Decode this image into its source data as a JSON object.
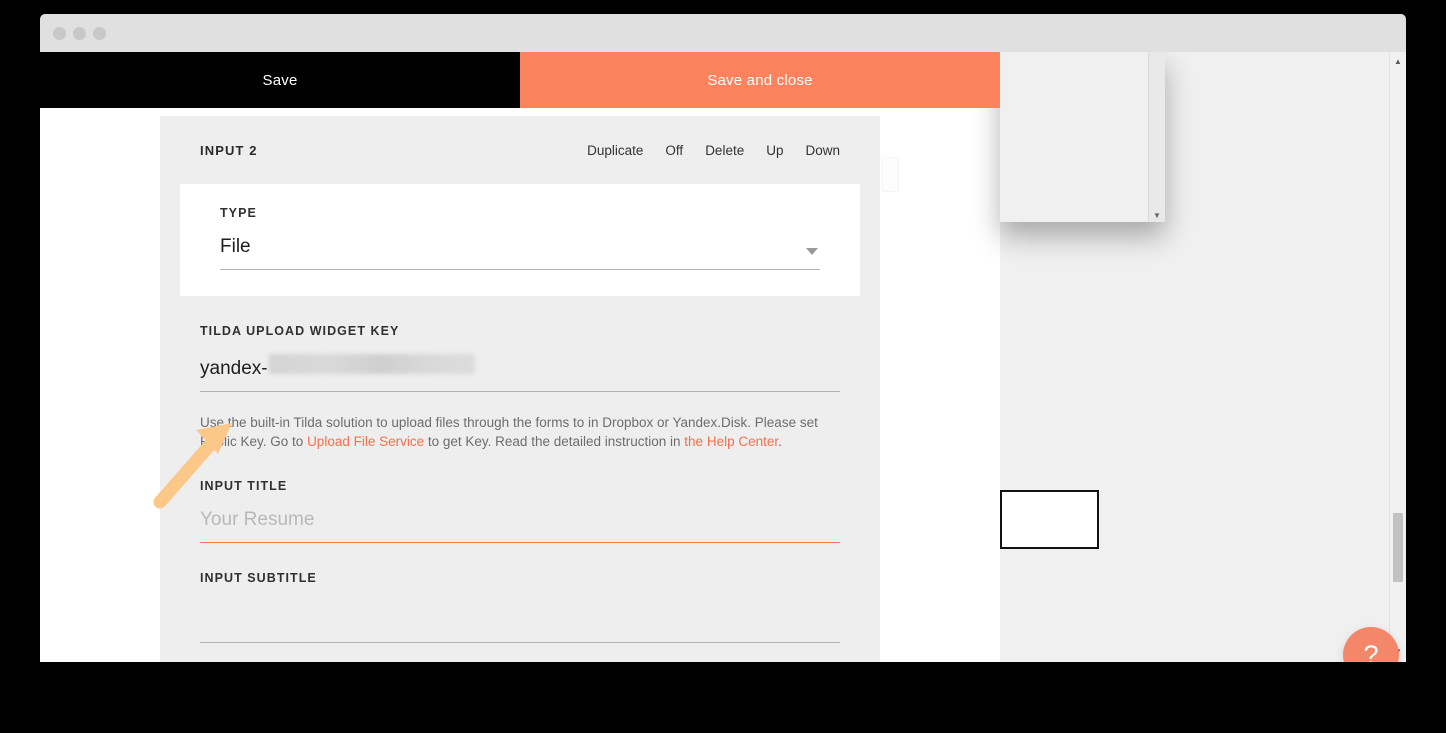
{
  "window": {
    "traffic_lights": [
      "close",
      "minimize",
      "maximize"
    ]
  },
  "action_bar": {
    "save_label": "Save",
    "save_and_close_label": "Save and close"
  },
  "modal": {
    "title": "INPUT 2",
    "actions": [
      {
        "name": "duplicate",
        "label": "Duplicate"
      },
      {
        "name": "off",
        "label": "Off"
      },
      {
        "name": "delete",
        "label": "Delete"
      },
      {
        "name": "up",
        "label": "Up"
      },
      {
        "name": "down",
        "label": "Down"
      }
    ],
    "type_field": {
      "label": "TYPE",
      "value": "File",
      "caret_icon": "chevron-down-icon"
    },
    "widget_key_field": {
      "label": "TILDA UPLOAD WIDGET KEY",
      "value_prefix": "yandex-",
      "value_redacted": true
    },
    "help_text": {
      "part1": "Use the built-in Tilda solution to upload files through the forms to in Dropbox or Yandex.Disk. Please set Public Key. Go to ",
      "link1": "Upload File Service",
      "part2": " to get Key. Read the detailed instruction in ",
      "link2": "the Help Center",
      "part3": "."
    },
    "input_title_field": {
      "label": "INPUT TITLE",
      "value": "",
      "placeholder": "Your Resume",
      "focused": true
    },
    "input_subtitle_field": {
      "label": "INPUT SUBTITLE",
      "value": "",
      "placeholder": ""
    }
  },
  "scrollbar": {
    "up_arrow_icon": "triangle-up-icon",
    "down_arrow_icon": "triangle-down-icon"
  },
  "inner_panel": {
    "down_arrow_icon": "triangle-down-icon"
  },
  "help_bubble": {
    "label": "?",
    "icon": "question-mark-icon"
  },
  "annotation": {
    "type": "arrow",
    "color": "#fbc88a",
    "points_to": "tilda-upload-widget-key-field"
  },
  "colors": {
    "accent_orange": "#fc835d",
    "link_orange": "#f4704a",
    "help_bubble": "#f4866a",
    "modal_background": "#eeeeee",
    "toolbar_black": "#000000"
  }
}
